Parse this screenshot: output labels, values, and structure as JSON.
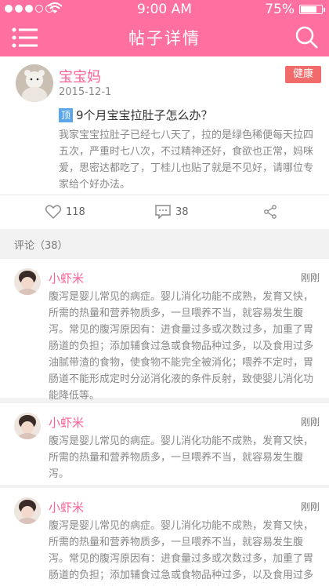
{
  "status": {
    "time": "9:00 AM",
    "battery": "75%"
  },
  "nav": {
    "title": "帖子详情"
  },
  "post": {
    "author": "宝宝妈",
    "date": "2015-12-1",
    "tag": "健康",
    "title_badge": "顶",
    "title": "9个月宝宝拉肚子怎么办？",
    "body": "我家宝宝拉肚子已经七八天了，拉的是绿色稀便每天拉四五次，严重时七八次，不过精神还好，食欲也正常，妈咪爱，思密达都吃了，丁桂儿也贴了就是不见好，请哪位专家给个好办法。"
  },
  "actions": {
    "likes": "118",
    "comments": "38"
  },
  "comments_header": "评论（38）",
  "comments": [
    {
      "author": "小虾米",
      "time": "刚刚",
      "body": "腹泻是婴儿常见的病症。婴儿消化功能不成熟，发育又快，所需的热量和营养物质多，一旦喂养不当，就容易发生腹泻。常见的腹泻原因有：进食量过多或次数过多，加重了胃肠道的负担；添加辅食过急或食物品种过多，以及食用过多油腻带渣的食物，使食物不能完全被消化；喂养不定时，胃肠道不能形成定时分泌消化液的条件反射，致使婴儿消化功能降低等。"
    },
    {
      "author": "小虾米",
      "time": "刚刚",
      "body": "腹泻是婴儿常见的病症。婴儿消化功能不成熟，发育又快，所需的热量和营养物质多，一旦喂养不当，就容易发生腹泻。"
    },
    {
      "author": "小虾米",
      "time": "刚刚",
      "body": "腹泻是婴儿常见的病症。婴儿消化功能不成熟，发育又快，所需的热量和营养物质多，一旦喂养不当，就容易发生腹泻。常见的腹泻原因有：进食量过多或次数过多，加重了胃肠道的负担；添加辅食过急或食物品种过多，以及食用过多油腻带渣的食物，使食物不能完全被消化；"
    }
  ],
  "colors": {
    "primary": "#ff6fa0",
    "accent_text": "#ff5f96",
    "tag_bg": "#f26b6b",
    "badge_bg": "#5aa6e8"
  },
  "icons": {
    "menu": "menu-icon",
    "search": "search-icon",
    "like": "heart-icon",
    "comment": "comment-icon",
    "share": "share-icon"
  }
}
